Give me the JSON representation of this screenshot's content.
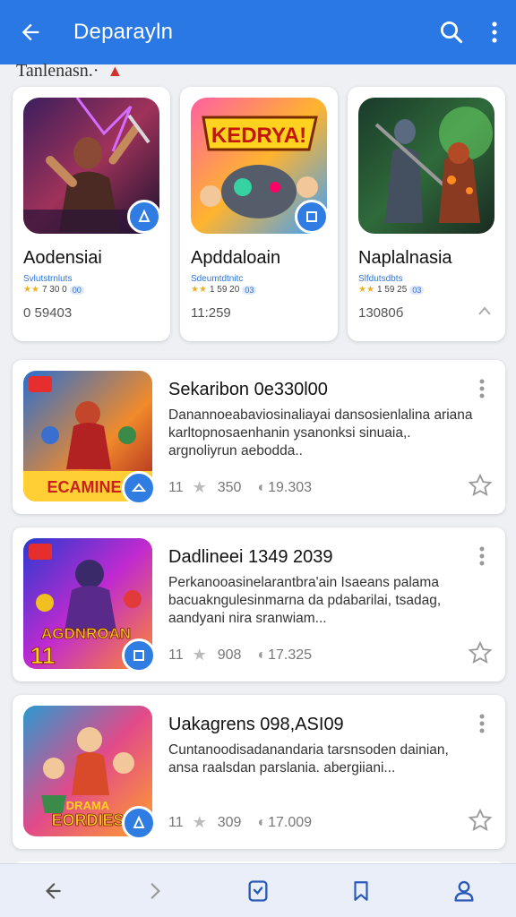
{
  "appbar": {
    "title": "Deparayln",
    "back_icon": "arrow-left-icon",
    "search_icon": "search-icon",
    "menu_icon": "more-vert-icon",
    "color": "#2a78e4"
  },
  "section": {
    "title": "Tanlenasn.·",
    "flame": "▲"
  },
  "featured": [
    {
      "name": "Aodensiai",
      "sub": "Svlutstrnluts",
      "stars": "★★",
      "rating": "7 30 0",
      "pill": "00",
      "size": "0 59403"
    },
    {
      "name": "Apddaloain",
      "sub": "Sdeumtdtnitc",
      "stars": "★★",
      "rating": "1 59 20",
      "pill": "03",
      "size": "11:259"
    },
    {
      "name": "Naplalnasia",
      "sub": "Slfdutsdbts",
      "stars": "★★",
      "rating": "1 59 25",
      "pill": "03",
      "size": "13080б"
    }
  ],
  "list": [
    {
      "title": "Sekaribon 0e330l00",
      "desc": "Danannoeabaviosinaliayai dansosienlalina ariana karltopnosaenhanin ysanonksi sinuaia,. argnoliyrun aebodda..",
      "count": "11",
      "rating": "350",
      "downloads": "19.303",
      "thumb_label": "ECAMINE"
    },
    {
      "title": "Dadlineei 1349 2039",
      "desc": "Perkanooasinelarantbra'ain Isaeans palama bacuakngulesinmarna da pdabarilai, tsadag, aandyani nira sranwiam...",
      "count": "11",
      "rating": "908",
      "downloads": "17.325",
      "thumb_label": "AGDNROAN"
    },
    {
      "title": "Uakagrens 098,ASI09",
      "desc": "Cuntanoodisadanandaria tarsnsoden dainian, ansa raalsdan parslania. abergiiani...",
      "count": "11",
      "rating": "309",
      "downloads": "17.009",
      "thumb_label": "EORDIES"
    }
  ],
  "nav": {
    "items": [
      "back-nav-icon",
      "forward-nav-icon",
      "home-tab-icon",
      "bookmark-icon",
      "profile-icon"
    ]
  }
}
